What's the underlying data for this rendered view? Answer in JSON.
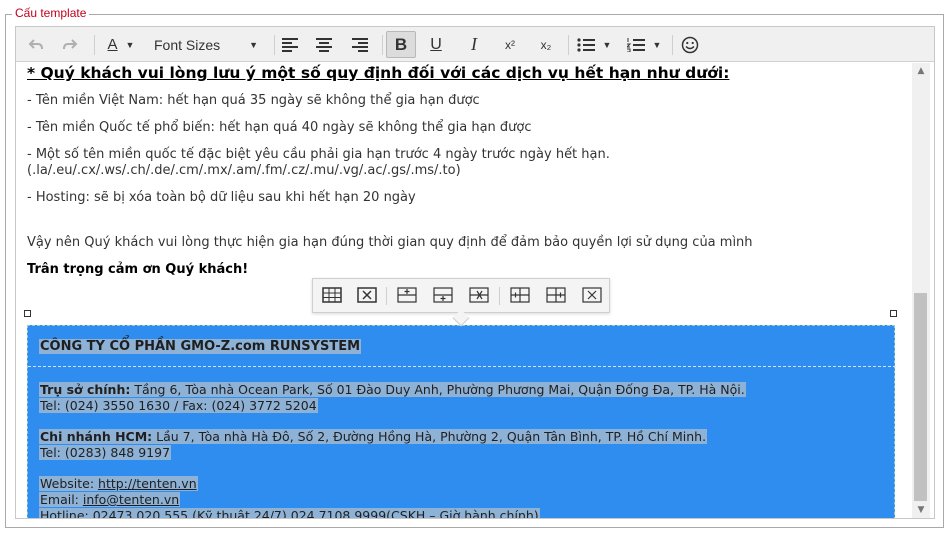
{
  "fieldset": {
    "legend": "Cấu template"
  },
  "toolbar": {
    "undo_icon": "undo-icon",
    "redo_icon": "redo-icon",
    "text_color_letter": "A",
    "font_sizes_label": "Font Sizes",
    "bold_label": "B",
    "underline_label": "U",
    "italic_label": "I",
    "superscript_label": "x²",
    "subscript_label": "x₂",
    "emoji_icon": "smiley-icon"
  },
  "content": {
    "heading": "* Quý khách vui lòng lưu ý một số quy định đối với các dịch vụ hết hạn như dưới:",
    "line1": "- Tên miền Việt Nam: hết hạn quá 35 ngày sẽ không thể gia hạn được",
    "line2": "- Tên miền Quốc tế phổ biến: hết hạn quá 40 ngày sẽ không thể gia hạn được",
    "line3a": "- Một số tên miền quốc tế đặc biệt yêu cầu phải gia hạn trước 4 ngày trước ngày hết hạn.",
    "line3b": "(.la/.eu/.cx/.ws/.ch/.de/.cm/.mx/.am/.fm/.cz/.mu/.vg/.ac/.gs/.ms/.to)",
    "line4": "- Hosting: sẽ bị xóa toàn bộ dữ liệu sau khi hết hạn 20 ngày",
    "line5": "Vậy nên Quý khách vui lòng thực hiện gia hạn đúng thời gian quy định để đảm bảo quyền lợi sử dụng của mình",
    "thanks": "Trân trọng cảm ơn Quý khách!"
  },
  "company": {
    "name": "CÔNG TY CỔ PHẦN GMO-Z.com RUNSYSTEM",
    "hq_label": "Trụ sở chính:",
    "hq_address": " Tầng 6, Tòa nhà Ocean Park, Số 01 Đào Duy Anh, Phường Phương Mai, Quận Đống Đa, TP. Hà Nội.",
    "hq_phone": "Tel: (024) 3550 1630 / Fax: (024) 3772 5204",
    "hcm_label": "Chi nhánh HCM:",
    "hcm_address": " Lầu 7, Tòa nhà Hà Đô, Số 2, Đường Hồng Hà, Phường 2, Quận Tân Bình, TP. Hồ Chí Minh.",
    "hcm_phone": "Tel: (0283) 848 9197",
    "website_label": "Website: ",
    "website_url": "http://tenten.vn",
    "email_label": "Email: ",
    "email": "info@tenten.vn",
    "hotline": "Hotline: 02473 020 555 (Kỹ thuật 24/7) 024.7108.9999(CSKH – Giờ hành chính)"
  },
  "colors": {
    "legend": "#c0001c",
    "selection": "#2f8df0",
    "highlight": "#8eb1d6"
  }
}
